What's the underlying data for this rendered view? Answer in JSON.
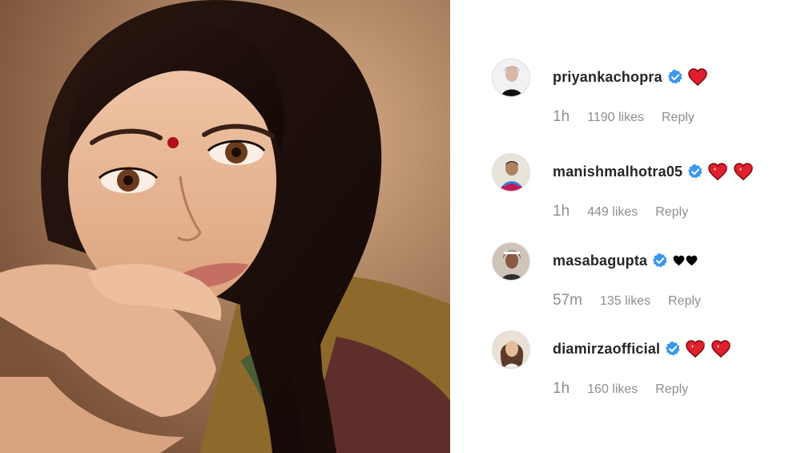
{
  "comments": [
    {
      "username": "priyankachopra",
      "verified": true,
      "emoji": [
        "red-heart"
      ],
      "time": "1h",
      "likes": "1190 likes",
      "reply": "Reply"
    },
    {
      "username": "manishmalhotra05",
      "verified": true,
      "emoji": [
        "sparkling-heart",
        "sparkling-heart"
      ],
      "time": "1h",
      "likes": "449 likes",
      "reply": "Reply"
    },
    {
      "username": "masabagupta",
      "verified": true,
      "emoji": [
        "black-heart",
        "black-heart"
      ],
      "time": "57m",
      "likes": "135 likes",
      "reply": "Reply"
    },
    {
      "username": "diamirzaofficial",
      "verified": true,
      "emoji": [
        "sparkling-heart",
        "sparkling-heart"
      ],
      "time": "1h",
      "likes": "160 likes",
      "reply": "Reply"
    }
  ],
  "colors": {
    "verified_blue": "#3897f0",
    "heart_red": "#d31f2b",
    "username": "#262626",
    "meta_gray": "#8e8e8e"
  }
}
